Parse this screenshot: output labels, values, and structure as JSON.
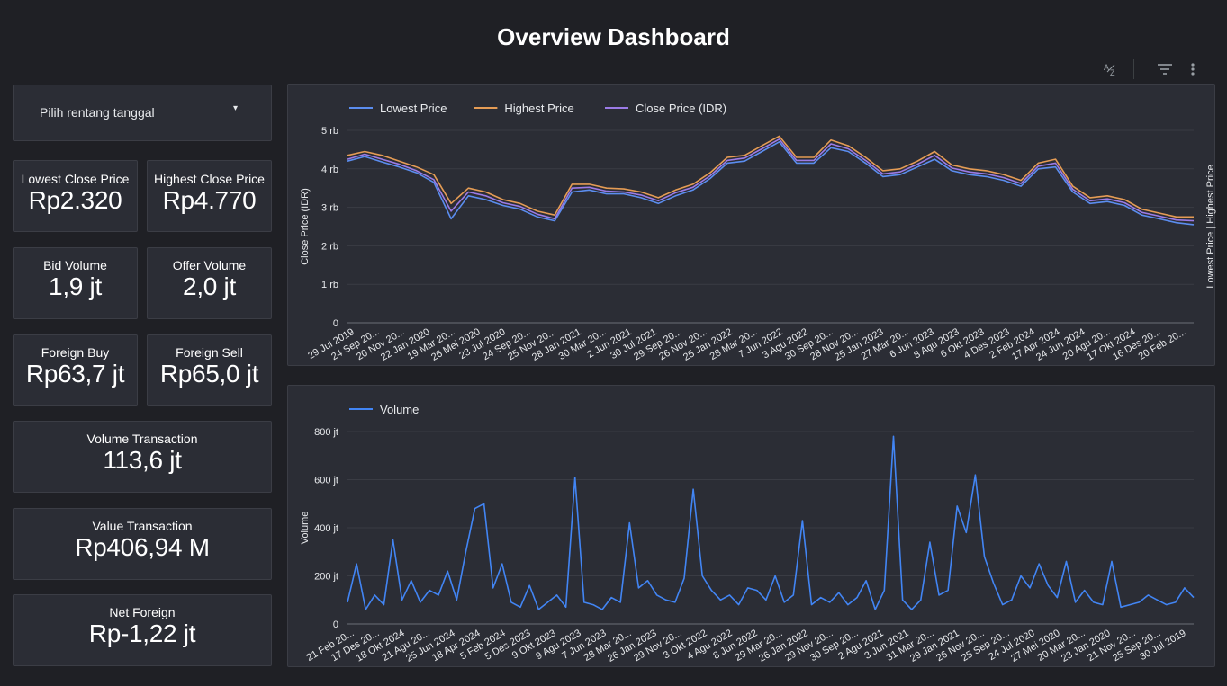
{
  "page": {
    "title": "Overview Dashboard"
  },
  "toolbar": {
    "sort_icon": "sort-az-icon",
    "filter_icon": "filter-icon",
    "more_icon": "more-vert-icon"
  },
  "date_picker": {
    "label": "Pilih rentang tanggal"
  },
  "scorecards": {
    "lowest_close": {
      "label": "Lowest Close Price",
      "value": "Rp2.320"
    },
    "highest_close": {
      "label": "Highest Close Price",
      "value": "Rp4.770"
    },
    "bid_volume": {
      "label": "Bid Volume",
      "value": "1,9 jt"
    },
    "offer_volume": {
      "label": "Offer Volume",
      "value": "2,0 jt"
    },
    "foreign_buy": {
      "label": "Foreign Buy",
      "value": "Rp63,7 jt"
    },
    "foreign_sell": {
      "label": "Foreign Sell",
      "value": "Rp65,0 jt"
    },
    "volume_transaction": {
      "label": "Volume Transaction",
      "value": "113,6 jt"
    },
    "value_transaction": {
      "label": "Value Transaction",
      "value": "Rp406,94 M"
    },
    "net_foreign": {
      "label": "Net Foreign",
      "value": "Rp-1,22 jt"
    }
  },
  "colors": {
    "background": "#1f2025",
    "card": "#2b2d35",
    "lowest": "#5b8def",
    "highest": "#e59c55",
    "close": "#9b7be6",
    "volume": "#4285f4",
    "grid": "#3a3c44"
  },
  "chart_data": [
    {
      "type": "line",
      "legend_position": "top-left",
      "grid": true,
      "ylabel": "Close Price (IDR)",
      "ylabel_right": "Lowest Price | Highest Price",
      "ylim": [
        0,
        5000
      ],
      "y_ticks": [
        "0",
        "1 rb",
        "2 rb",
        "3 rb",
        "4 rb",
        "5 rb"
      ],
      "x_tick_labels": [
        "29 Jul 2019",
        "24 Sep 20...",
        "20 Nov 20...",
        "22 Jan 2020",
        "19 Mar 20...",
        "26 Mei 2020",
        "23 Jul 2020",
        "24 Sep 20...",
        "25 Nov 20...",
        "28 Jan 2021",
        "30 Mar 20...",
        "2 Jun 2021",
        "30 Jul 2021",
        "29 Sep 20...",
        "26 Nov 20...",
        "25 Jan 2022",
        "28 Mar 20...",
        "7 Jun 2022",
        "3 Agu 2022",
        "30 Sep 20...",
        "28 Nov 20...",
        "25 Jan 2023",
        "27 Mar 20...",
        "6 Jun 2023",
        "8 Agu 2023",
        "6 Okt 2023",
        "4 Des 2023",
        "2 Feb 2024",
        "17 Apr 2024",
        "24 Jun 2024",
        "20 Agu 20...",
        "17 Okt 2024",
        "16 Des 20...",
        "20 Feb 20..."
      ],
      "series": [
        {
          "name": "Lowest Price",
          "color": "#5b8def",
          "values": [
            4200,
            4320,
            4180,
            4050,
            3900,
            3650,
            2700,
            3300,
            3200,
            3050,
            2950,
            2750,
            2650,
            3400,
            3450,
            3350,
            3350,
            3250,
            3100,
            3300,
            3450,
            3750,
            4150,
            4200,
            4450,
            4700,
            4150,
            4150,
            4550,
            4450,
            4150,
            3800,
            3850,
            4050,
            4250,
            3950,
            3850,
            3800,
            3700,
            3550,
            4000,
            4050,
            3400,
            3100,
            3150,
            3050,
            2800,
            2700,
            2600,
            2550
          ]
        },
        {
          "name": "Highest Price",
          "color": "#e59c55",
          "values": [
            4350,
            4450,
            4350,
            4200,
            4050,
            3850,
            3100,
            3500,
            3400,
            3200,
            3100,
            2900,
            2800,
            3600,
            3600,
            3500,
            3480,
            3400,
            3250,
            3450,
            3600,
            3900,
            4300,
            4350,
            4600,
            4850,
            4300,
            4300,
            4750,
            4600,
            4300,
            3950,
            4000,
            4200,
            4450,
            4100,
            4000,
            3950,
            3850,
            3700,
            4150,
            4250,
            3550,
            3250,
            3300,
            3200,
            2950,
            2850,
            2750,
            2750
          ]
        },
        {
          "name": "Close Price (IDR)",
          "color": "#9b7be6",
          "values": [
            4250,
            4380,
            4250,
            4120,
            3950,
            3720,
            2900,
            3400,
            3300,
            3120,
            3020,
            2820,
            2700,
            3500,
            3520,
            3420,
            3400,
            3320,
            3170,
            3380,
            3520,
            3820,
            4220,
            4280,
            4520,
            4770,
            4220,
            4220,
            4650,
            4520,
            4220,
            3870,
            3920,
            4120,
            4350,
            4020,
            3920,
            3870,
            3770,
            3620,
            4070,
            4150,
            3470,
            3170,
            3220,
            3120,
            2870,
            2770,
            2670,
            2650
          ]
        }
      ]
    },
    {
      "type": "line",
      "legend_position": "top-left",
      "grid": true,
      "ylabel": "Volume",
      "ylim": [
        0,
        800000000
      ],
      "y_ticks": [
        "0",
        "200 jt",
        "400 jt",
        "600 jt",
        "800 jt"
      ],
      "x_tick_labels": [
        "21 Feb 20...",
        "17 Des 20...",
        "18 Okt 2024",
        "21 Agu 20...",
        "25 Jun 2024",
        "18 Apr 2024",
        "5 Feb 2024",
        "5 Des 2023",
        "9 Okt 2023",
        "9 Agu 2023",
        "7 Jun 2023",
        "28 Mar 20...",
        "26 Jan 2023",
        "29 Nov 20...",
        "3 Okt 2022",
        "4 Agu 2022",
        "8 Jun 2022",
        "29 Mar 20...",
        "26 Jan 2022",
        "29 Nov 20...",
        "30 Sep 20...",
        "2 Agu 2021",
        "3 Jun 2021",
        "31 Mar 20...",
        "29 Jan 2021",
        "26 Nov 20...",
        "25 Sep 20...",
        "24 Jul 2020",
        "27 Mei 2020",
        "20 Mar 20...",
        "23 Jan 2020",
        "21 Nov 20...",
        "25 Sep 20...",
        "30 Jul 2019"
      ],
      "series": [
        {
          "name": "Volume",
          "color": "#4285f4",
          "values": [
            90000000,
            250000000,
            60000000,
            120000000,
            80000000,
            350000000,
            100000000,
            180000000,
            90000000,
            140000000,
            120000000,
            220000000,
            100000000,
            300000000,
            480000000,
            500000000,
            150000000,
            250000000,
            90000000,
            70000000,
            160000000,
            60000000,
            90000000,
            120000000,
            70000000,
            610000000,
            90000000,
            80000000,
            60000000,
            110000000,
            90000000,
            420000000,
            150000000,
            180000000,
            120000000,
            100000000,
            90000000,
            190000000,
            560000000,
            200000000,
            140000000,
            100000000,
            120000000,
            80000000,
            150000000,
            140000000,
            100000000,
            200000000,
            90000000,
            120000000,
            430000000,
            80000000,
            110000000,
            90000000,
            130000000,
            80000000,
            110000000,
            180000000,
            60000000,
            140000000,
            780000000,
            100000000,
            60000000,
            100000000,
            340000000,
            120000000,
            140000000,
            490000000,
            380000000,
            620000000,
            280000000,
            170000000,
            80000000,
            100000000,
            200000000,
            150000000,
            250000000,
            160000000,
            110000000,
            260000000,
            90000000,
            140000000,
            90000000,
            80000000,
            260000000,
            70000000,
            80000000,
            90000000,
            120000000,
            100000000,
            80000000,
            90000000,
            150000000,
            110000000
          ]
        }
      ]
    }
  ]
}
